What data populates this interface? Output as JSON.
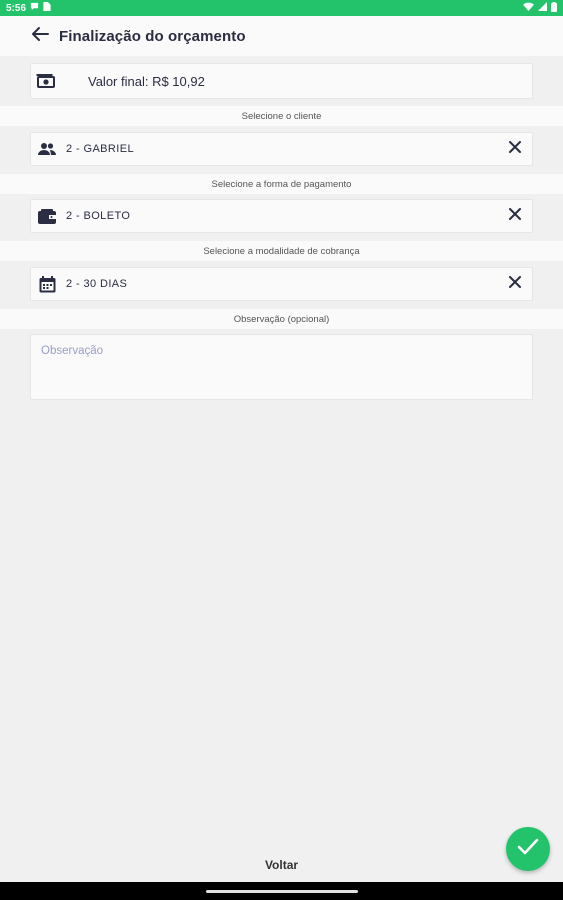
{
  "status_bar": {
    "time": "5:56"
  },
  "app_bar": {
    "title": "Finalização do orçamento"
  },
  "total": {
    "label": "Valor final: R$ 10,92"
  },
  "client": {
    "section_label": "Selecione o cliente",
    "value": "2 - GABRIEL"
  },
  "payment": {
    "section_label": "Selecione a forma de pagamento",
    "value": "2 - BOLETO"
  },
  "billing": {
    "section_label": "Selecione a modalidade de cobrança",
    "value": "2 - 30 DIAS"
  },
  "observation": {
    "section_label": "Observação (opcional)",
    "placeholder": "Observação",
    "value": ""
  },
  "footer": {
    "back_label": "Voltar"
  },
  "colors": {
    "accent": "#22c36b",
    "text_dark": "#2b2d42",
    "background": "#f0f0f0"
  },
  "icons": [
    "back-arrow-icon",
    "money-icon",
    "people-icon",
    "wallet-icon",
    "calendar-icon",
    "close-icon",
    "check-icon"
  ]
}
